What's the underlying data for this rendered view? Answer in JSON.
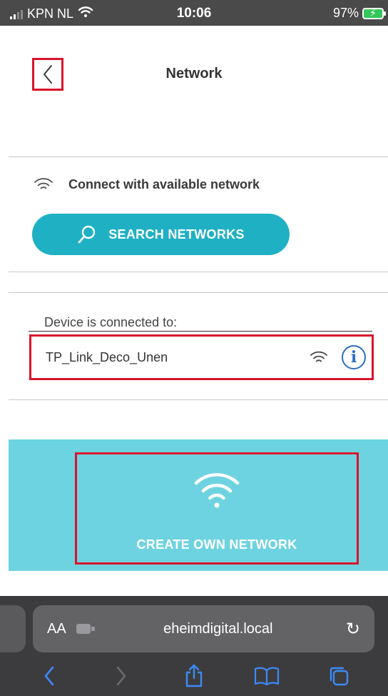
{
  "status_bar": {
    "carrier": "KPN NL",
    "time": "10:06",
    "battery": "97%"
  },
  "header": {
    "title": "Network",
    "back_icon": "chevron-left-icon"
  },
  "connect_section": {
    "label": "Connect with available network",
    "icon": "wifi-icon",
    "search_button_label": "SEARCH NETWORKS",
    "search_icon": "search-icon"
  },
  "connected_section": {
    "label": "Device is connected to:",
    "network_name": "TP_Link_Deco_Unen",
    "wifi_icon": "wifi-icon",
    "info_icon": "info-icon",
    "info_glyph": "i"
  },
  "create_section": {
    "label": "CREATE OWN NETWORK",
    "icon": "wifi-icon"
  },
  "browser": {
    "text_size_label": "AA",
    "url": "eheimdigital.local",
    "reload_glyph": "↻"
  },
  "colors": {
    "accent": "#1fb1c3",
    "panel": "#6ed3e0",
    "highlight": "#d9142b",
    "info": "#2b6fc2"
  }
}
